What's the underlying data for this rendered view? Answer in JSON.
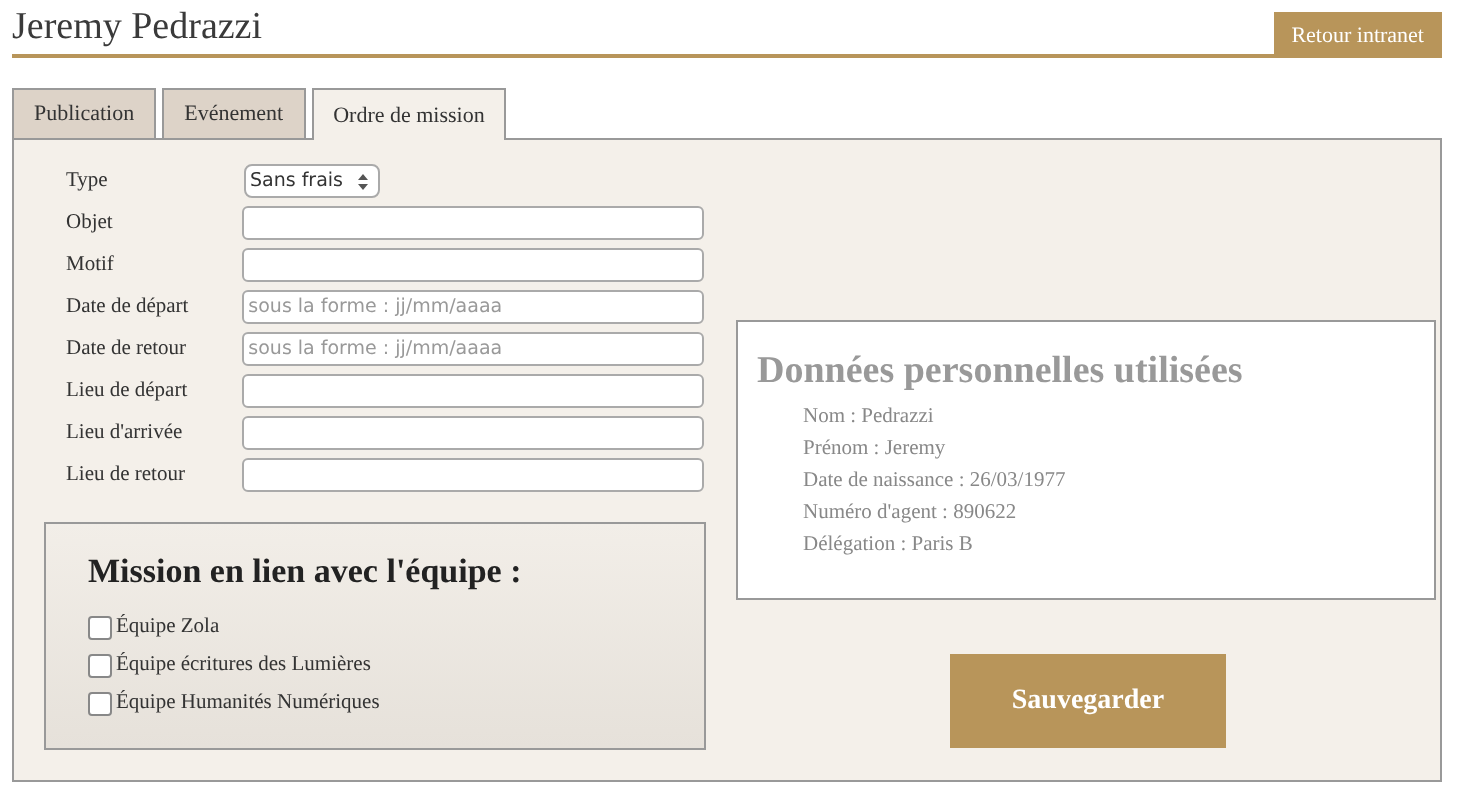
{
  "header": {
    "title": "Jeremy Pedrazzi",
    "back_button": "Retour intranet"
  },
  "tabs": [
    {
      "label": "Publication",
      "selected": false
    },
    {
      "label": "Evénement",
      "selected": false
    },
    {
      "label": "Ordre de mission",
      "selected": true
    }
  ],
  "form": {
    "fields": [
      {
        "label": "Type",
        "kind": "select",
        "value": "Sans frais"
      },
      {
        "label": "Objet",
        "kind": "text"
      },
      {
        "label": "Motif",
        "kind": "text"
      },
      {
        "label": "Date de départ",
        "kind": "text",
        "placeholder": "sous la forme : jj/mm/aaaa"
      },
      {
        "label": "Date de retour",
        "kind": "text",
        "placeholder": "sous la forme : jj/mm/aaaa"
      },
      {
        "label": "Lieu de départ",
        "kind": "text"
      },
      {
        "label": "Lieu d'arrivée",
        "kind": "text"
      },
      {
        "label": "Lieu de retour",
        "kind": "text"
      }
    ],
    "teams": {
      "title": "Mission en lien avec l'équipe :",
      "options": [
        {
          "label": "Équipe Zola",
          "checked": false
        },
        {
          "label": "Équipe écritures des Lumières",
          "checked": false
        },
        {
          "label": "Équipe Humanités Numériques",
          "checked": false
        }
      ]
    }
  },
  "personal_data": {
    "title": "Données personnelles utilisées",
    "lines": [
      "Nom : Pedrazzi",
      "Prénom : Jeremy",
      "Date de naissance : 26/03/1977",
      "Numéro d'agent : 890622",
      "Délégation : Paris B"
    ]
  },
  "save_button": "Sauvegarder"
}
